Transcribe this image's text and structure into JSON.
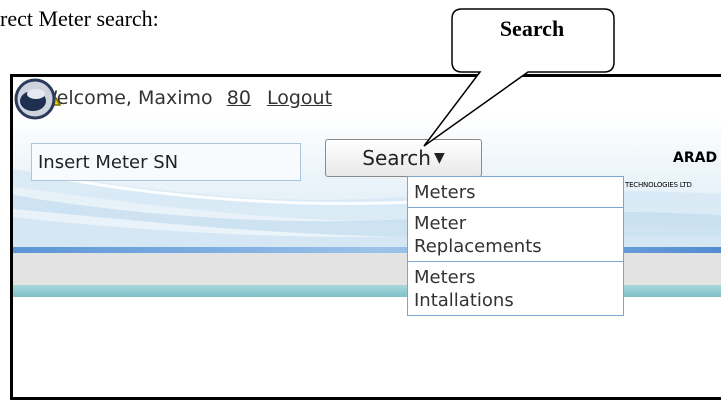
{
  "doc": {
    "text_fragment": "rect Meter search:"
  },
  "callout": {
    "label": "Search"
  },
  "header": {
    "welcome_text": "Welcome, Maximo",
    "alert_count": "80",
    "logout_label": "Logout"
  },
  "search": {
    "input_value": "Insert Meter SN",
    "button_label": "Search",
    "menu": [
      {
        "label": "Meters"
      },
      {
        "label": "Meter\nReplacements"
      },
      {
        "label": "Meters\nIntallations"
      }
    ]
  },
  "logo": {
    "name": "ARAD",
    "subtitle": "TECHNOLOGIES LTD"
  },
  "colors": {
    "accent_blue": "#4b86cf",
    "dropdown_border": "#7aa6cf",
    "teal_stripe": "#7fc0c9",
    "warning_yellow": "#f5d000"
  },
  "icons": {
    "alert": "warning-triangle-icon",
    "caret": "caret-down-icon",
    "logo": "arad-logo-icon"
  }
}
